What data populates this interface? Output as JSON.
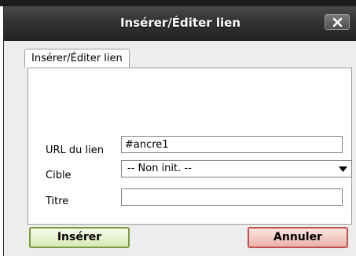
{
  "dialog": {
    "title": "Insérer/Éditer lien",
    "close_icon": "close-icon"
  },
  "tabs": [
    {
      "label": "Insérer/Éditer lien",
      "active": true
    }
  ],
  "form": {
    "url": {
      "label": "URL du lien",
      "value": "#ancre1"
    },
    "target": {
      "label": "Cible",
      "value": "-- Non init. --",
      "icon": "chevron-down-icon"
    },
    "title": {
      "label": "Titre",
      "value": ""
    }
  },
  "buttons": {
    "insert_label": "Insérer",
    "cancel_label": "Annuler"
  },
  "colors": {
    "titlebar": "#333333",
    "insert_border": "#7a9a3c",
    "cancel_border": "#c0504a"
  }
}
